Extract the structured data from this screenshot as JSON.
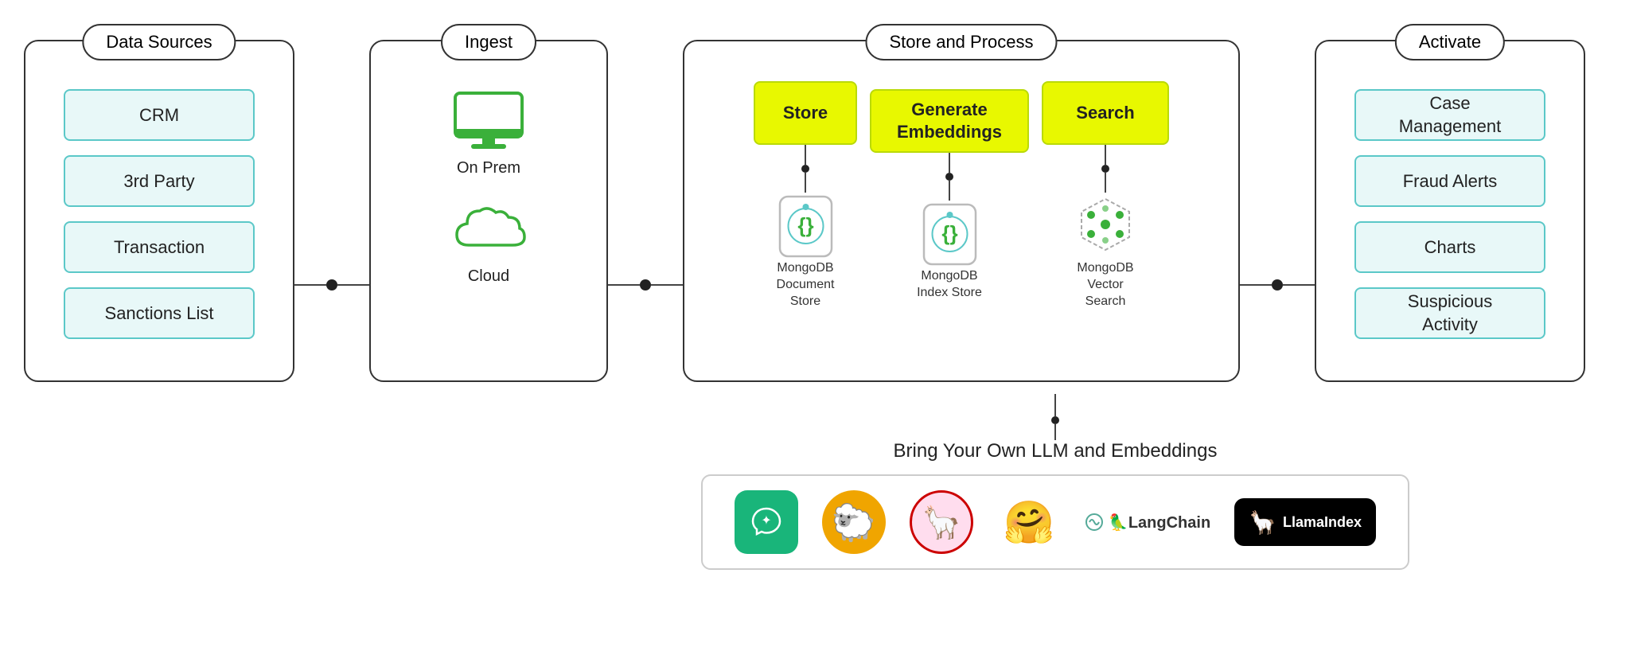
{
  "panels": {
    "data_sources": {
      "title": "Data Sources",
      "items": [
        {
          "label": "CRM"
        },
        {
          "label": "3rd Party"
        },
        {
          "label": "Transaction"
        },
        {
          "label": "Sanctions List"
        }
      ]
    },
    "ingest": {
      "title": "Ingest",
      "items": [
        {
          "label": "On Prem",
          "icon": "monitor"
        },
        {
          "label": "Cloud",
          "icon": "cloud"
        }
      ]
    },
    "store_process": {
      "title": "Store and Process",
      "top_boxes": [
        {
          "label": "Store"
        },
        {
          "label": "Generate\nEmbeddings"
        },
        {
          "label": "Search"
        }
      ],
      "db_items": [
        {
          "label": "MongoDB\nDocument\nStore"
        },
        {
          "label": "MongoDB\nIndex Store"
        },
        {
          "label": "MongoDB\nVector\nSearch"
        }
      ]
    },
    "activate": {
      "title": "Activate",
      "items": [
        {
          "label": "Case\nManagement"
        },
        {
          "label": "Fraud Alerts"
        },
        {
          "label": "Charts"
        },
        {
          "label": "Suspicious\nActivity"
        }
      ]
    }
  },
  "bottom": {
    "title": "Bring Your Own LLM and Embeddings",
    "logos": [
      {
        "name": "ChatGPT",
        "type": "chatgpt"
      },
      {
        "name": "HuggingFace Sheep",
        "type": "sheep"
      },
      {
        "name": "Llama",
        "type": "llama"
      },
      {
        "name": "HuggingFace Emoji",
        "type": "emoji"
      },
      {
        "name": "LangChain",
        "type": "langchain"
      },
      {
        "name": "LlamaIndex",
        "type": "llamaindex"
      }
    ]
  }
}
